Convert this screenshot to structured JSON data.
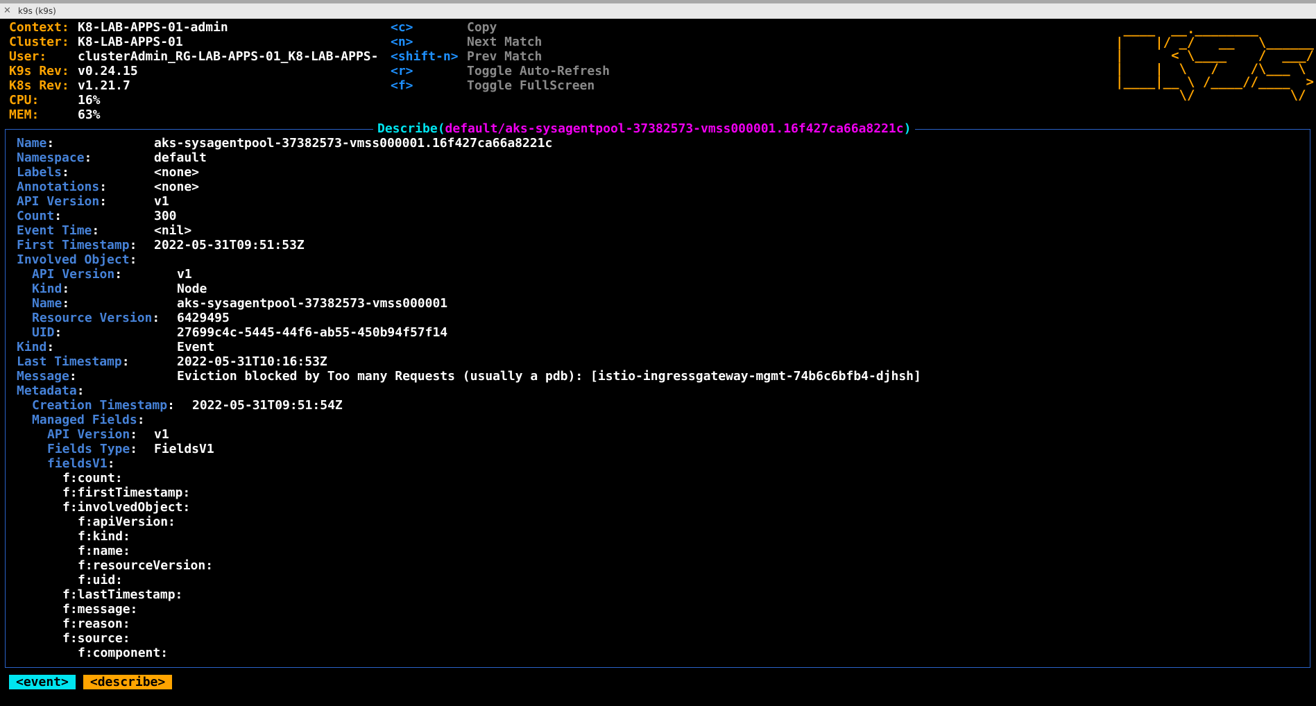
{
  "window": {
    "title": "k9s (k9s)"
  },
  "header": {
    "info": [
      {
        "label": "Context:",
        "value": "K8-LAB-APPS-01-admin"
      },
      {
        "label": "Cluster:",
        "value": "K8-LAB-APPS-01"
      },
      {
        "label": "User:",
        "value": "clusterAdmin_RG-LAB-APPS-01_K8-LAB-APPS-"
      },
      {
        "label": "K9s Rev:",
        "value": "v0.24.15"
      },
      {
        "label": "K8s Rev:",
        "value": "v1.21.7"
      },
      {
        "label": "CPU:",
        "value": "16%"
      },
      {
        "label": "MEM:",
        "value": "63%"
      }
    ],
    "shortcuts": [
      {
        "key": "<c>",
        "desc": "Copy"
      },
      {
        "key": "<n>",
        "desc": "Next Match"
      },
      {
        "key": "<shift-n>",
        "desc": "Prev Match"
      },
      {
        "key": "<r>",
        "desc": "Toggle Auto-Refresh"
      },
      {
        "key": "<f>",
        "desc": "Toggle FullScreen"
      }
    ],
    "logo": " ____  __.________        \n|    |/ _/   __   \\______ \n|      < \\____    /  ___/ \n|    |  \\   /    /\\___ \\  \n|____|__ \\ /____//____  > \n        \\/            \\/  "
  },
  "panel": {
    "title_prefix": "Describe(",
    "title_path": "default/aks-sysagentpool-37382573-vmss000001.16f427ca66a8221c",
    "title_suffix": ")"
  },
  "describe": [
    {
      "key": "Name",
      "value": "aks-sysagentpool-37382573-vmss000001.16f427ca66a8221c"
    },
    {
      "key": "Namespace",
      "value": "default"
    },
    {
      "key": "Labels",
      "value": "<none>"
    },
    {
      "key": "Annotations",
      "value": "<none>"
    },
    {
      "key": "API Version",
      "value": "v1"
    },
    {
      "key": "Count",
      "value": "300"
    },
    {
      "key": "Event Time",
      "value": "<nil>"
    },
    {
      "key": "First Timestamp",
      "value": "2022-05-31T09:51:53Z"
    },
    {
      "key": "Involved Object",
      "value": ""
    },
    {
      "key": "API Version",
      "value": "v1"
    },
    {
      "key": "Kind",
      "value": "Node"
    },
    {
      "key": "Name",
      "value": "aks-sysagentpool-37382573-vmss000001"
    },
    {
      "key": "Resource Version",
      "value": "6429495"
    },
    {
      "key": "UID",
      "value": "27699c4c-5445-44f6-ab55-450b94f57f14"
    },
    {
      "key": "Kind",
      "value": "Event"
    },
    {
      "key": "Last Timestamp",
      "value": "2022-05-31T10:16:53Z"
    },
    {
      "key": "Message",
      "value": "Eviction blocked by Too many Requests (usually a pdb): [istio-ingressgateway-mgmt-74b6c6bfb4-djhsh]"
    },
    {
      "key": "Metadata",
      "value": ""
    },
    {
      "key": "Creation Timestamp",
      "value": "2022-05-31T09:51:54Z"
    },
    {
      "key": "Managed Fields",
      "value": ""
    },
    {
      "key": "API Version",
      "value": "v1"
    },
    {
      "key": "Fields Type",
      "value": "FieldsV1"
    },
    {
      "key": "fieldsV1",
      "value": ""
    },
    {
      "key": "f:count:",
      "value": ""
    },
    {
      "key": "f:firstTimestamp:",
      "value": ""
    },
    {
      "key": "f:involvedObject:",
      "value": ""
    },
    {
      "key": "f:apiVersion:",
      "value": ""
    },
    {
      "key": "f:kind:",
      "value": ""
    },
    {
      "key": "f:name:",
      "value": ""
    },
    {
      "key": "f:resourceVersion:",
      "value": ""
    },
    {
      "key": "f:uid:",
      "value": ""
    },
    {
      "key": "f:lastTimestamp:",
      "value": ""
    },
    {
      "key": "f:message:",
      "value": ""
    },
    {
      "key": "f:reason:",
      "value": ""
    },
    {
      "key": "f:source:",
      "value": ""
    },
    {
      "key": "f:component:",
      "value": ""
    }
  ],
  "breadcrumbs": [
    "<event>",
    "<describe>"
  ]
}
